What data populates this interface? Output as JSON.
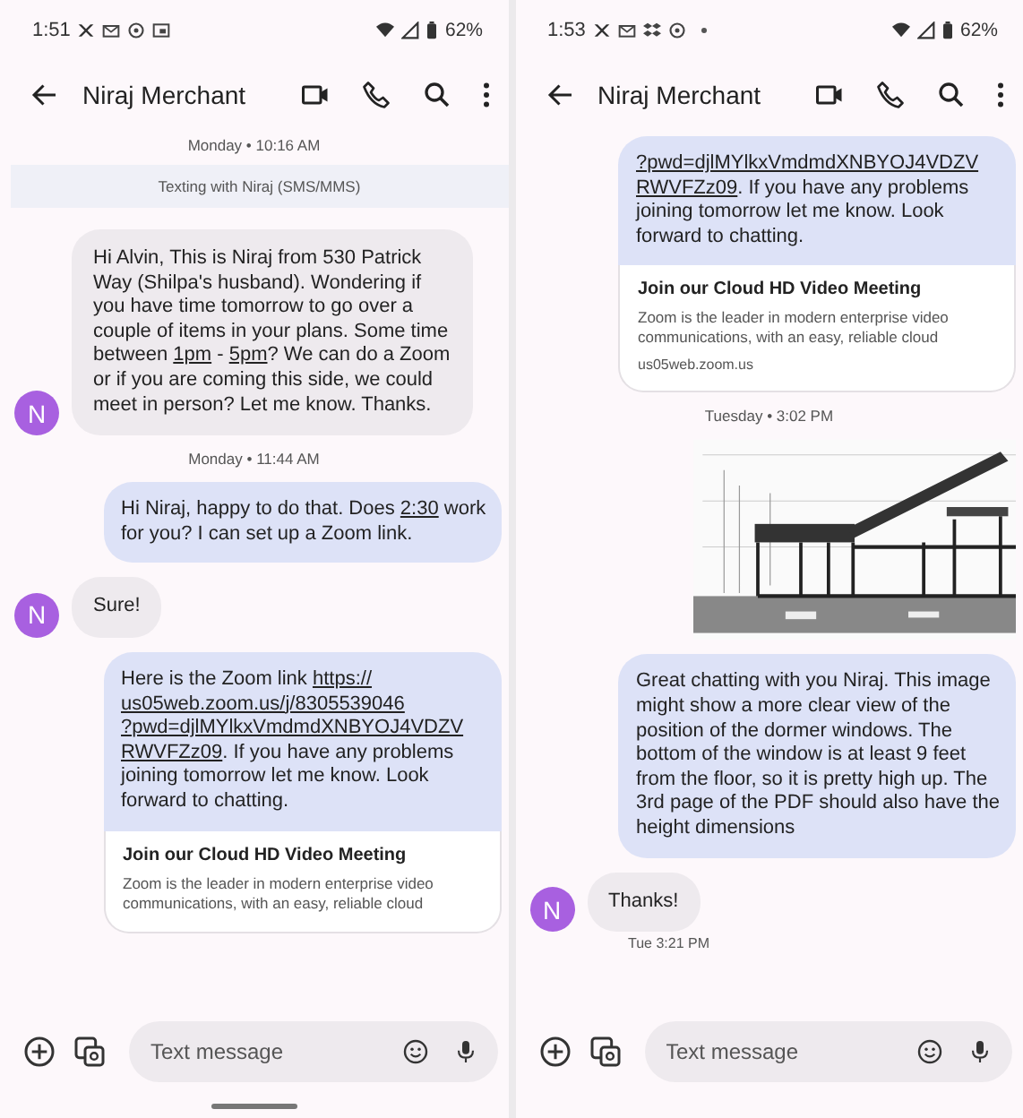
{
  "phones": [
    {
      "status_bar": {
        "time": "1:51",
        "battery": "62%"
      },
      "header": {
        "title": "Niraj Merchant"
      },
      "gesture_bar": true,
      "messages": [
        {
          "kind": "timestamp",
          "text": "Monday • 10:16 AM"
        },
        {
          "kind": "banner",
          "text": "Texting with Niraj (SMS/MMS)"
        },
        {
          "kind": "incoming",
          "avatar": "N",
          "segments": [
            {
              "text": "Hi Alvin, This is Niraj from 530 Patrick Way (Shilpa's husband). Wondering if you have time tomorrow to go over a couple of items in your plans. Some time between ",
              "link": false
            },
            {
              "text": "1pm",
              "link": true
            },
            {
              "text": " - ",
              "link": false
            },
            {
              "text": "5pm",
              "link": true
            },
            {
              "text": "? We can do a Zoom or if you are coming this side, we could meet in person? Let me know. Thanks.",
              "link": false
            }
          ]
        },
        {
          "kind": "timestamp",
          "text": "Monday • 11:44 AM"
        },
        {
          "kind": "outgoing",
          "segments": [
            {
              "text": "Hi Niraj, happy to do that. Does ",
              "link": false
            },
            {
              "text": "2:30",
              "link": true
            },
            {
              "text": " work for you? I can set up a Zoom link.",
              "link": false
            }
          ]
        },
        {
          "kind": "incoming",
          "avatar": "N",
          "segments": [
            {
              "text": "Sure!",
              "link": false
            }
          ]
        },
        {
          "kind": "outgoing",
          "segments": [
            {
              "text": "Here is the Zoom link ",
              "link": false
            },
            {
              "text": "https://",
              "link": true
            },
            {
              "text": "us05web.zoom.us/j/8305539046",
              "link": true
            },
            {
              "text": "?pwd=djlMYlkxVmdmdXNBYOJ4VDZV",
              "link": true
            },
            {
              "text": "RWVFZz09",
              "link": true
            },
            {
              "text": ". If you have any problems joining tomorrow let me know. Look forward to chatting.",
              "link": false
            }
          ],
          "preview": {
            "title": "Join our Cloud HD Video Meeting",
            "description": "Zoom is the leader in modern enterprise video communications, with an easy, reliable cloud"
          }
        }
      ],
      "composer": {
        "placeholder": "Text message"
      }
    },
    {
      "status_bar": {
        "time": "1:53",
        "battery": "62%"
      },
      "header": {
        "title": "Niraj Merchant"
      },
      "gesture_bar": false,
      "messages": [
        {
          "kind": "outgoing",
          "segments": [
            {
              "text": "?pwd=djlMYlkxVmdmdXNBYOJ4VDZV",
              "link": true
            },
            {
              "text": "RWVFZz09",
              "link": true
            },
            {
              "text": ". If you have any problems joining tomorrow let me know. Look forward to chatting.",
              "link": false
            }
          ],
          "preview": {
            "title": "Join our Cloud HD Video Meeting",
            "description": "Zoom is the leader in modern enterprise video communications, with an easy, reliable cloud",
            "domain": "us05web.zoom.us"
          }
        },
        {
          "kind": "timestamp",
          "text": "Tuesday • 3:02 PM"
        },
        {
          "kind": "image"
        },
        {
          "kind": "outgoing",
          "segments": [
            {
              "text": "Great chatting with you Niraj. This image might show a more clear view of the position of the dormer windows. The bottom of the window is at least 9 feet from the floor, so it is pretty high up. The 3rd page of the PDF should also have the height dimensions",
              "link": false
            }
          ]
        },
        {
          "kind": "incoming",
          "avatar": "N",
          "segments": [
            {
              "text": "Thanks!",
              "link": false
            }
          ],
          "meta": "Tue 3:21 PM"
        }
      ],
      "composer": {
        "placeholder": "Text message"
      }
    }
  ]
}
